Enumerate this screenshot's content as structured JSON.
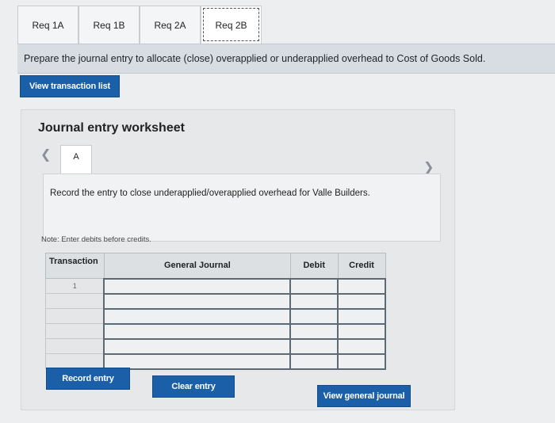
{
  "tabs": [
    {
      "label": "Req 1A",
      "active": false
    },
    {
      "label": "Req 1B",
      "active": false
    },
    {
      "label": "Req 2A",
      "active": false
    },
    {
      "label": "Req 2B",
      "active": true
    }
  ],
  "instruction": "Prepare the journal entry to allocate (close) overapplied or underapplied overhead to Cost of Goods Sold.",
  "view_transaction_list_label": "View transaction list",
  "worksheet": {
    "title": "Journal entry worksheet",
    "prev_icon": "chevron-left-icon",
    "next_icon": "chevron-right-icon",
    "entry_tab_label": "A",
    "entry_description": "Record the entry to close underapplied/overapplied overhead for Valle Builders.",
    "note": "Note: Enter debits before credits.",
    "columns": [
      "Transaction",
      "General Journal",
      "Debit",
      "Credit"
    ],
    "rows": [
      {
        "transaction": "1",
        "general_journal": "",
        "debit": "",
        "credit": ""
      },
      {
        "transaction": "",
        "general_journal": "",
        "debit": "",
        "credit": ""
      },
      {
        "transaction": "",
        "general_journal": "",
        "debit": "",
        "credit": ""
      },
      {
        "transaction": "",
        "general_journal": "",
        "debit": "",
        "credit": ""
      },
      {
        "transaction": "",
        "general_journal": "",
        "debit": "",
        "credit": ""
      },
      {
        "transaction": "",
        "general_journal": "",
        "debit": "",
        "credit": ""
      }
    ]
  },
  "buttons": {
    "record_entry": "Record entry",
    "clear_entry": "Clear entry",
    "view_general_journal": "View general journal"
  },
  "colors": {
    "button_blue": "#1b5fa8",
    "instruction_bar": "#d7dde3"
  }
}
